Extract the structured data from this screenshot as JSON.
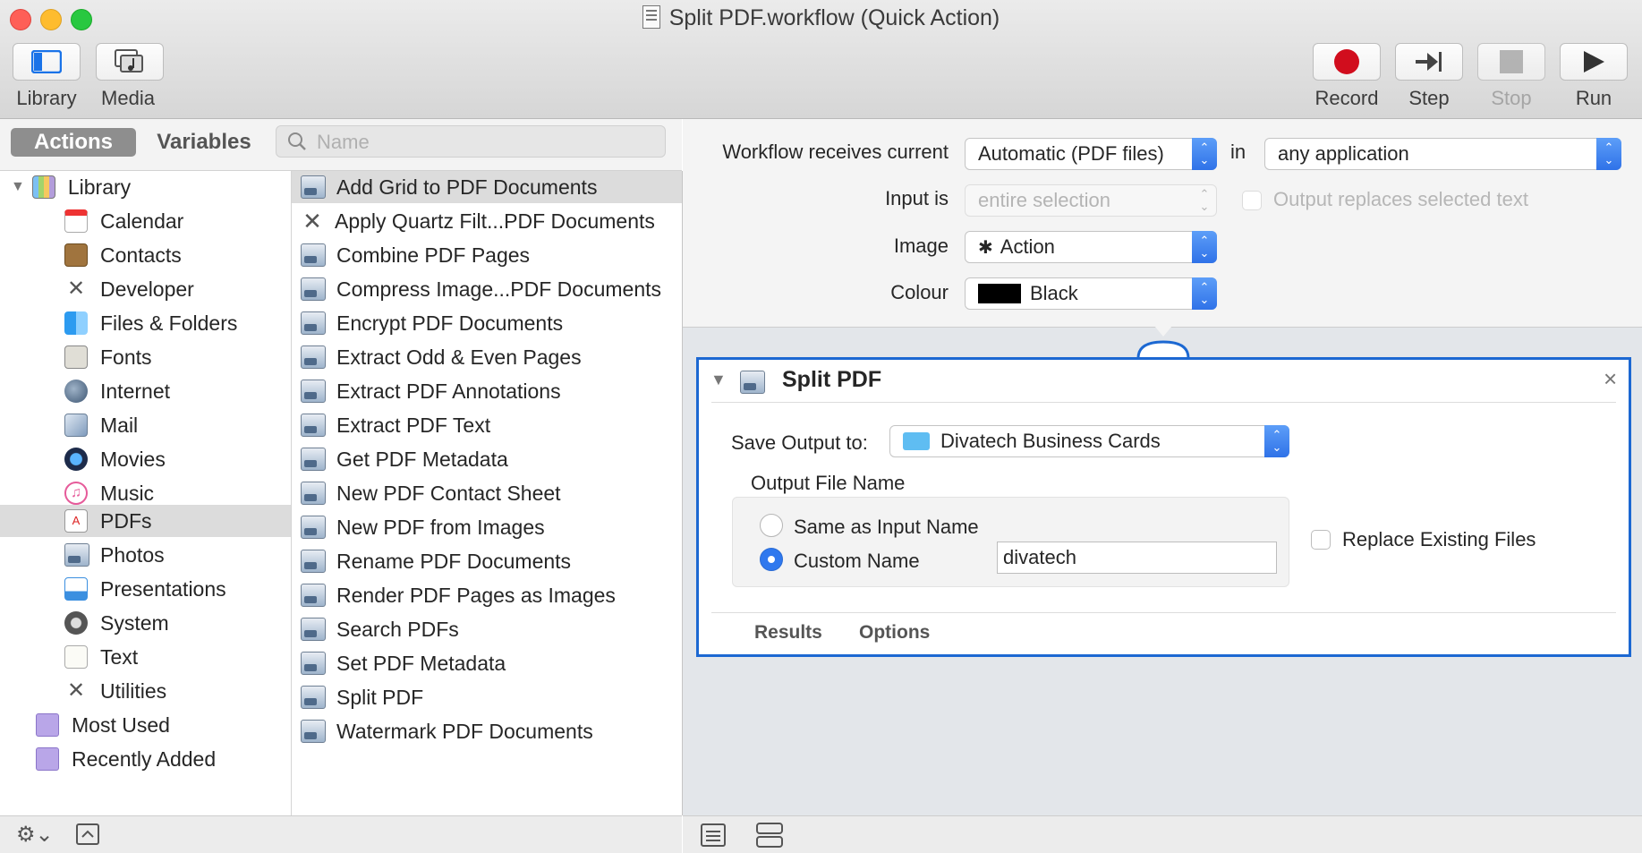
{
  "window": {
    "title": "Split PDF.workflow (Quick Action)",
    "traffic_lights": {
      "close": "#fe5f57",
      "minimize": "#febc2e",
      "zoom": "#28c840"
    }
  },
  "toolbar": {
    "library_label": "Library",
    "media_label": "Media",
    "record_label": "Record",
    "step_label": "Step",
    "stop_label": "Stop",
    "run_label": "Run"
  },
  "sidebar": {
    "tab_actions": "Actions",
    "tab_variables": "Variables",
    "search_placeholder": "Name",
    "library_root": "Library",
    "categories": [
      "Calendar",
      "Contacts",
      "Developer",
      "Files & Folders",
      "Fonts",
      "Internet",
      "Mail",
      "Movies",
      "Music",
      "PDFs",
      "Photos",
      "Presentations",
      "System",
      "Text",
      "Utilities"
    ],
    "selected_category": "PDFs",
    "smart_groups": [
      "Most Used",
      "Recently Added"
    ]
  },
  "actions": {
    "items": [
      "Add Grid to PDF Documents",
      "Apply Quartz Filt...PDF Documents",
      "Combine PDF Pages",
      "Compress Image...PDF Documents",
      "Encrypt PDF Documents",
      "Extract Odd & Even Pages",
      "Extract PDF Annotations",
      "Extract PDF Text",
      "Get PDF Metadata",
      "New PDF Contact Sheet",
      "New PDF from Images",
      "Rename PDF Documents",
      "Render PDF Pages as Images",
      "Search PDFs",
      "Set PDF Metadata",
      "Split PDF",
      "Watermark PDF Documents"
    ],
    "selected": "Add Grid to PDF Documents"
  },
  "workflow": {
    "receives_label": "Workflow receives current",
    "receives_value": "Automatic (PDF files)",
    "in_label": "in",
    "in_value": "any application",
    "input_is_label": "Input is",
    "input_is_value": "entire selection",
    "output_replaces_label": "Output replaces selected text",
    "image_label": "Image",
    "image_value": "Action",
    "colour_label": "Colour",
    "colour_value": "Black",
    "colour_swatch": "#000000"
  },
  "card": {
    "title": "Split PDF",
    "save_output_label": "Save Output to:",
    "save_output_value": "Divatech Business Cards",
    "output_file_name_label": "Output File Name",
    "same_as_input_label": "Same as Input Name",
    "custom_name_label": "Custom Name",
    "custom_name_value": "divatech",
    "replace_existing_label": "Replace Existing Files",
    "results_tab": "Results",
    "options_tab": "Options",
    "selected_radio": "Custom Name"
  },
  "colors": {
    "accent": "#1c68d2",
    "record_red": "#d10d1d",
    "folder_blue": "#5fbdf2"
  }
}
